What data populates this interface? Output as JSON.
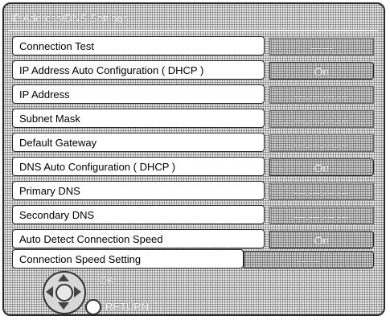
{
  "title": "IP Address/DNS Settings",
  "rows": [
    {
      "label": "Connection Test",
      "value": "------"
    },
    {
      "label": "IP Address Auto Configuration ( DHCP )",
      "value": "On"
    },
    {
      "label": "IP Address",
      "value": "---.---.---.---"
    },
    {
      "label": "Subnet Mask",
      "value": "---.---.---.---"
    },
    {
      "label": "Default Gateway",
      "value": "---.---.---.---"
    },
    {
      "label": "DNS Auto Configuration ( DHCP )",
      "value": "On"
    },
    {
      "label": "Primary DNS",
      "value": "---.---.---.---"
    },
    {
      "label": "Secondary DNS",
      "value": "---.---.---.---"
    },
    {
      "label": "Auto Detect Connection Speed",
      "value": "On"
    },
    {
      "label": "Connection Speed Setting",
      "value": "------"
    }
  ],
  "footer": {
    "ok_label": "OK",
    "return_label": "RETURN"
  }
}
